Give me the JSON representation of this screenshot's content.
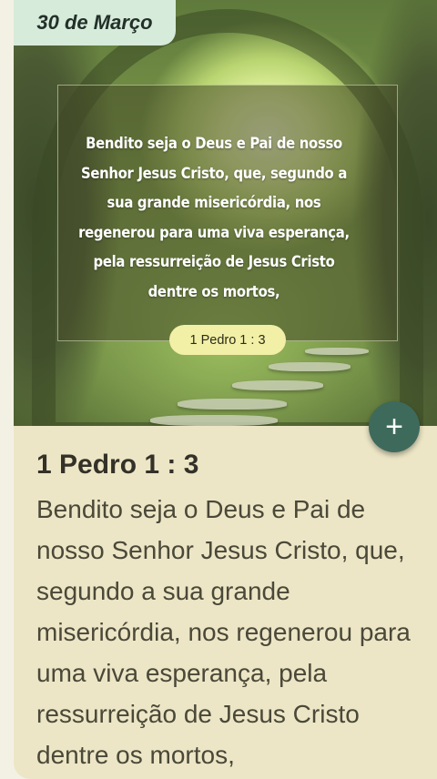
{
  "date_label": "30 de Março",
  "image_overlay": {
    "verse_text": "Bendito seja o Deus e Pai de nosso Senhor Jesus Cristo, que, segundo a sua grande misericórdia, nos regenerou para uma viva esperança, pela ressurreição de Jesus Cristo dentre os mortos,",
    "reference": "1 Pedro 1 : 3"
  },
  "fab": {
    "label": "+",
    "icon": "plus-icon",
    "color": "#3e6a5c"
  },
  "content": {
    "reference_heading": "1 Pedro 1 : 3",
    "verse_body": "Bendito seja o Deus e Pai de nosso Senhor Jesus Cristo, que, segundo a sua grande misericórdia, nos regenerou para uma viva esperança, pela ressurreição de Jesus Cristo dentre os mortos,"
  },
  "colors": {
    "card_bg": "#ece6c6",
    "tab_bg": "#d6ebda",
    "pill_bg": "#f2efa6"
  }
}
